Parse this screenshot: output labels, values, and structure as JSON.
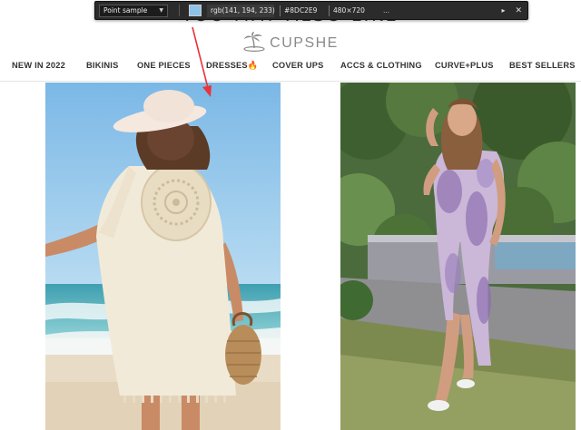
{
  "page": {
    "cut_heading": "YOU MAY ALSO LIKE"
  },
  "color_picker": {
    "mode": "Point sample",
    "swatch_color": "#8DC2E9",
    "rgb": "rgb(141, 194, 233)",
    "hex": "#8DC2E9",
    "size": "480×720",
    "more": "...",
    "next_icon": "chevron-right-icon",
    "close_icon": "close-icon"
  },
  "brand": {
    "name": "CUPSHE",
    "logo_icon": "palm-tree-icon"
  },
  "nav": {
    "items": [
      {
        "label": "NEW IN 2022"
      },
      {
        "label": "BIKINIS"
      },
      {
        "label": "ONE PIECES"
      },
      {
        "label": "DRESSES🔥"
      },
      {
        "label": "COVER UPS"
      },
      {
        "label": "ACCS & CLOTHING"
      },
      {
        "label": "CURVE+PLUS"
      },
      {
        "label": "BEST SELLERS"
      }
    ]
  },
  "products": [
    {
      "image": "crochet-cover-up-photo"
    },
    {
      "image": "tie-dye-maxi-dress-photo"
    }
  ],
  "colors": {
    "sky": "#8DC2E9",
    "annotation_arrow": "#e8343b",
    "toolbar_bg": "#2b2b2b"
  }
}
